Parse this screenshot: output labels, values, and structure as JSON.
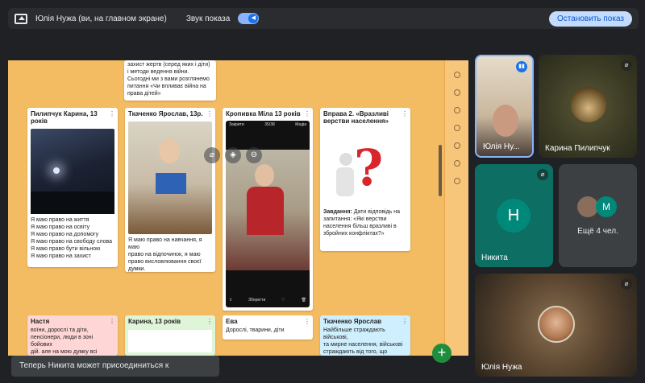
{
  "topbar": {
    "presenter": "Юлія Нужа (ви, на главном экране)",
    "sound_label": "Звук показа",
    "stop_button": "Остановить показ"
  },
  "cards": {
    "top_text": "захист жертв (серед яких і діти)\nі методи ведення війни.\nСьогодні  ми з вами розглянемо\nпитання «Чи впливає війна на\nправа дітей»",
    "karina_title": "Пилипчук Карина, 13 років",
    "karina_text": "Я маю право на життя\nЯ маю право на освіту\nЯ маю право на допомогу\nЯ маю право на свободу слова\nЯ маю право бути вільною\nЯ маю право на захист",
    "yaroslav_title": "Ткаченко Ярослав, 13р.",
    "yaroslav_text": "Я маю право на навчання, я маю\nправо на відпочинок, я маю\nправо висловлювання своєї\nдумки.",
    "mila_title": "Кропивка Міла 13 років",
    "phone_left": "Закрити",
    "phone_count": "35/38",
    "phone_right": "Медіа",
    "phone_save": "Зберегти",
    "exercise_title": "Вправа 2. «Вразливі\nверстви населення»",
    "exercise_label": "Завдання:",
    "exercise_text": "Дати відповідь на\nзапитання: «Які верстви\nнаселення більш вразливі в\nзбройних конфліктах?»",
    "nastya_title": "Настя",
    "nastya_text": "воїни, дорослі та діти,\nпенсіонери, люди в зоні бойових\nдій. але на мою думку всі",
    "karina2_title": "Карина, 13 років",
    "eva_title": "Ева",
    "eva_text": "Дорослі, тварини, діти",
    "yaroslav2_title": "Ткаченко Ярослав",
    "yaroslav2_text": "Найбільше страждають військові,\nта мирне населення, військові\nстраждають від того, що\nзахищають нашу країну, а мирне\nнаселення страждає від того,"
  },
  "toast": "Теперь Никита может присоединиться к видеовстрече.",
  "participants": {
    "self_name": "Юлія Ну...",
    "karina_name": "Карина Пилипчук",
    "nikita_letter": "Н",
    "nikita_name": "Никита",
    "more_letter": "М",
    "more_label": "Ещё 4 чел.",
    "yulia_name": "Юлія Нужа"
  }
}
